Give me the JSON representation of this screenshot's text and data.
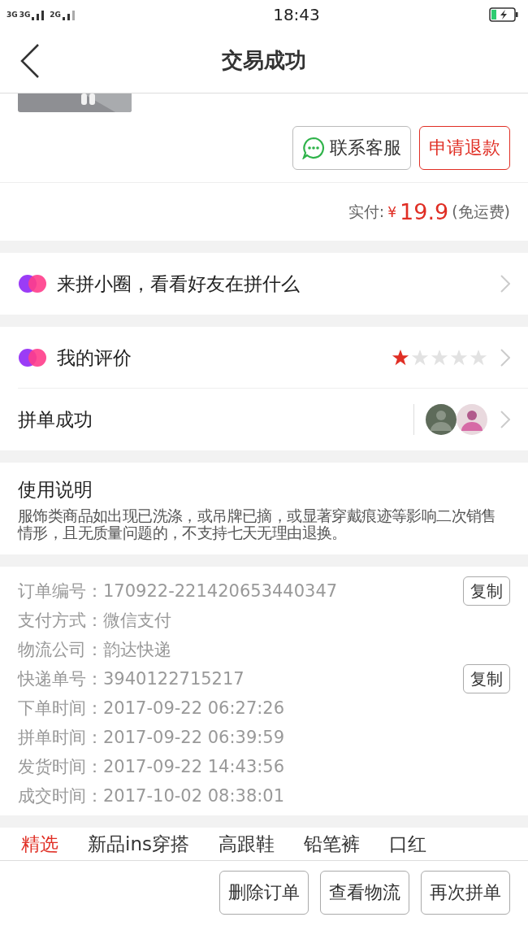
{
  "status_bar": {
    "network_1": "3G",
    "network_2": "3G",
    "network_3": "2G",
    "time": "18:43"
  },
  "nav": {
    "title": "交易成功"
  },
  "actions": [
    {
      "label": "联系客服",
      "kind": "chat"
    },
    {
      "label": "申请退款",
      "kind": "danger"
    }
  ],
  "payment": {
    "label": "实付:",
    "currency": "¥",
    "amount": "19.9",
    "note": "(免运费)"
  },
  "circle": {
    "label": "来拼小圈，看看好友在拼什么"
  },
  "review": {
    "label": "我的评价",
    "stars": 1
  },
  "group": {
    "label": "拼单成功"
  },
  "usage": {
    "title": "使用说明",
    "text": "服饰类商品如出现已洗涤，或吊牌已摘，或显著穿戴痕迹等影响二次销售情形，且无质量问题的，不支持七天无理由退换。"
  },
  "order_info": [
    {
      "label": "订单编号：",
      "value": "170922-221420653440347",
      "copy": "复制"
    },
    {
      "label": "支付方式：",
      "value": "微信支付"
    },
    {
      "label": "物流公司：",
      "value": "韵达快递"
    },
    {
      "label": "快递单号：",
      "value": "3940122715217",
      "copy": "复制"
    },
    {
      "label": "下单时间：",
      "value": "2017-09-22 06:27:26"
    },
    {
      "label": "拼单时间：",
      "value": "2017-09-22 06:39:59"
    },
    {
      "label": "发货时间：",
      "value": "2017-09-22 14:43:56"
    },
    {
      "label": "成交时间：",
      "value": "2017-10-02 08:38:01"
    }
  ],
  "category_tabs": [
    {
      "label": "精选",
      "selected": true
    },
    {
      "label": "新品ins穿搭",
      "selected": false
    },
    {
      "label": "高跟鞋",
      "selected": false
    },
    {
      "label": "铅笔裤",
      "selected": false
    },
    {
      "label": "口红",
      "selected": false
    }
  ],
  "bottom_buttons": [
    "删除订单",
    "查看物流",
    "再次拼单"
  ]
}
